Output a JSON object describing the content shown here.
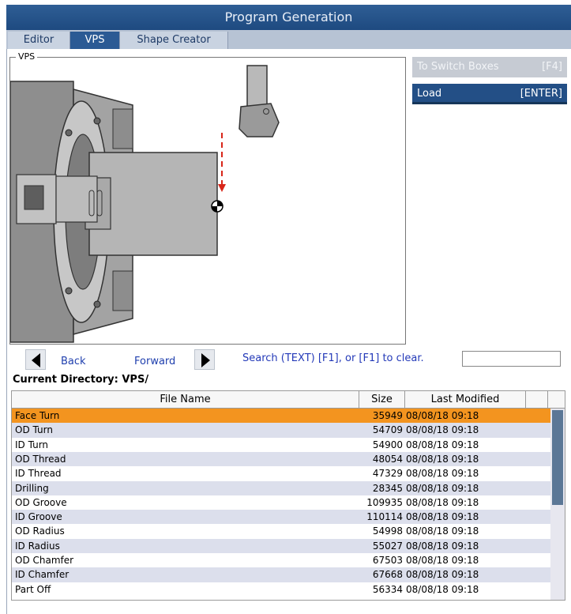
{
  "window": {
    "title": "Program Generation"
  },
  "tabs": [
    {
      "label": "Editor",
      "active": false
    },
    {
      "label": "VPS",
      "active": true
    },
    {
      "label": "Shape Creator",
      "active": false
    }
  ],
  "vps_panel": {
    "legend": "VPS"
  },
  "side_buttons": {
    "switch": {
      "label": "To Switch Boxes",
      "key": "[F4]"
    },
    "load": {
      "label": "Load",
      "key": "[ENTER]"
    }
  },
  "navigation": {
    "back_label": "Back",
    "forward_label": "Forward",
    "search_hint": "Search (TEXT) [F1], or [F1] to clear.",
    "search_value": ""
  },
  "current_directory": "Current Directory: VPS/",
  "file_table": {
    "columns": [
      "File Name",
      "Size",
      "Last Modified"
    ],
    "rows": [
      {
        "name": "Face Turn",
        "size": "35949",
        "modified": "08/08/18 09:18",
        "selected": true
      },
      {
        "name": "OD Turn",
        "size": "54709",
        "modified": "08/08/18 09:18"
      },
      {
        "name": "ID Turn",
        "size": "54900",
        "modified": "08/08/18 09:18"
      },
      {
        "name": "OD Thread",
        "size": "48054",
        "modified": "08/08/18 09:18"
      },
      {
        "name": "ID Thread",
        "size": "47329",
        "modified": "08/08/18 09:18"
      },
      {
        "name": "Drilling",
        "size": "28345",
        "modified": "08/08/18 09:18"
      },
      {
        "name": "OD Groove",
        "size": "109935",
        "modified": "08/08/18 09:18"
      },
      {
        "name": "ID Groove",
        "size": "110114",
        "modified": "08/08/18 09:18"
      },
      {
        "name": "OD Radius",
        "size": "54998",
        "modified": "08/08/18 09:18"
      },
      {
        "name": "ID Radius",
        "size": "55027",
        "modified": "08/08/18 09:18"
      },
      {
        "name": "OD Chamfer",
        "size": "67503",
        "modified": "08/08/18 09:18"
      },
      {
        "name": "ID Chamfer",
        "size": "67668",
        "modified": "08/08/18 09:18"
      },
      {
        "name": "Part Off",
        "size": "56334",
        "modified": "08/08/18 09:18"
      }
    ]
  },
  "colors": {
    "title_bar": "#1e4a80",
    "active_tab": "#2b5a94",
    "selected_row": "#f3941f",
    "alt_row": "#dcdfec",
    "link_text": "#1f3fae"
  }
}
